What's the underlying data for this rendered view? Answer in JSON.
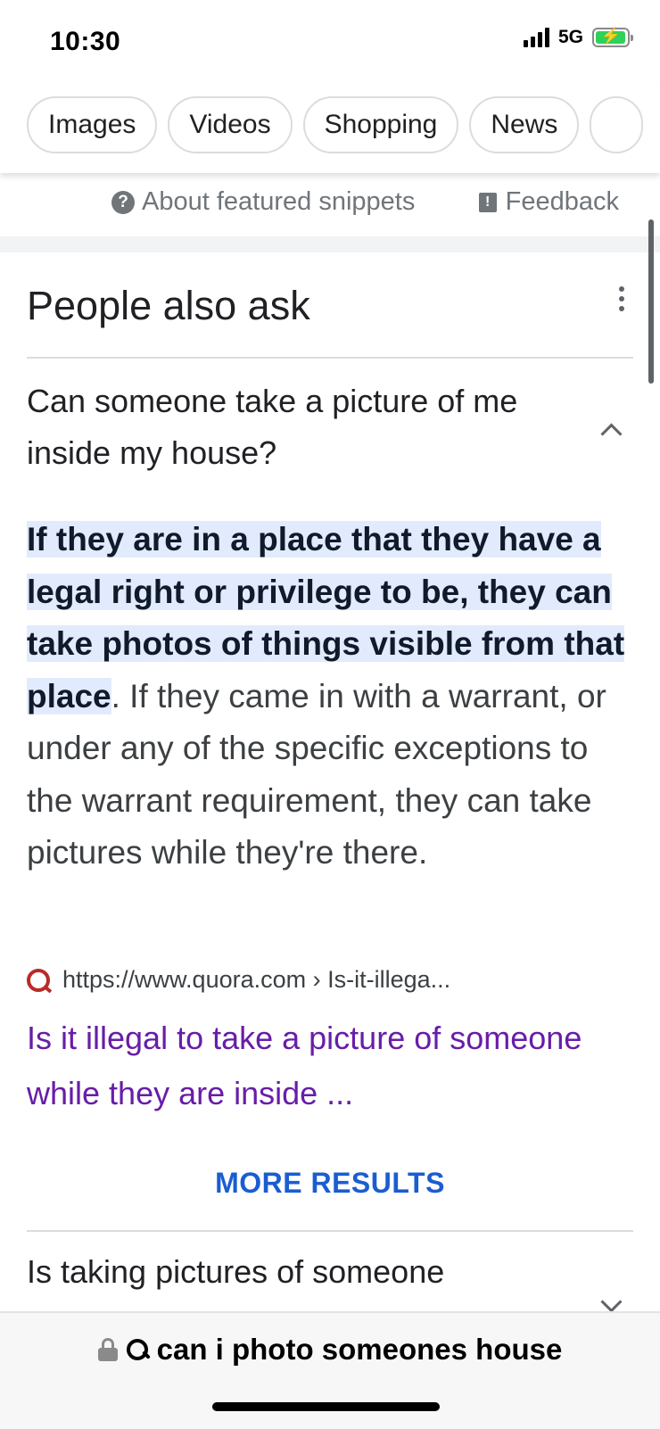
{
  "status": {
    "time": "10:30",
    "network": "5G",
    "battery_charging": true
  },
  "chips": [
    "Images",
    "Videos",
    "Shopping",
    "News"
  ],
  "snippet_footer": {
    "about_label": "About featured snippets",
    "feedback_label": "Feedback"
  },
  "paa": {
    "title": "People also ask",
    "question1": "Can someone take a picture of me inside my house?",
    "answer_highlight": "If they are in a place that they have a legal right or privilege to be, they can take photos of things visible from that place",
    "answer_rest": ". If they came in with a warrant, or under any of the specific exceptions to the warrant requirement, they can take pictures while they're there.",
    "source_url": "https://www.quora.com › Is-it-illega...",
    "result_title": "Is it illegal to take a picture of someone while they are inside ...",
    "more_results": "MORE RESULTS",
    "question2": "Is taking pictures of someone"
  },
  "url_bar": {
    "query": "can i photo someones house"
  },
  "colors": {
    "highlight": "#e2ebfd",
    "link_visited": "#681da8",
    "more_results": "#1a5dd2",
    "battery": "#30d158"
  }
}
